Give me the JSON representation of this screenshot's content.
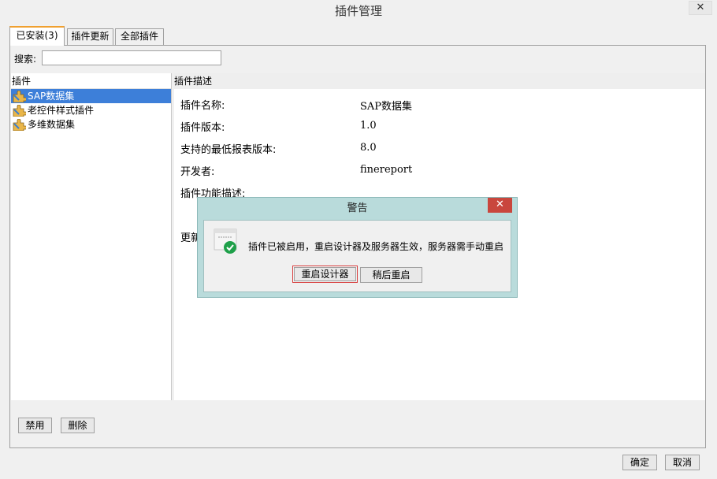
{
  "window": {
    "title": "插件管理",
    "close_label": "✕"
  },
  "tabs": [
    {
      "label": "已安装(3)"
    },
    {
      "label": "插件更新"
    },
    {
      "label": "全部插件"
    }
  ],
  "search": {
    "label": "搜索:",
    "value": ""
  },
  "plugin_list": {
    "header": "插件",
    "items": [
      {
        "label": "SAP数据集",
        "selected": true
      },
      {
        "label": "老控件样式插件"
      },
      {
        "label": "多维数据集"
      }
    ]
  },
  "description": {
    "header": "插件描述",
    "rows": [
      {
        "key": "插件名称:",
        "value": "SAP数据集"
      },
      {
        "key": "插件版本:",
        "value": "1.0"
      },
      {
        "key": "支持的最低报表版本:",
        "value": "8.0"
      },
      {
        "key": "开发者:",
        "value": "finereport"
      },
      {
        "key": "插件功能描述:",
        "value": ""
      },
      {
        "key": "更新",
        "value": ""
      }
    ]
  },
  "panel_buttons": {
    "disable": "禁用",
    "delete": "删除"
  },
  "footer_buttons": {
    "ok": "确定",
    "cancel": "取消"
  },
  "dialog": {
    "title": "警告",
    "close_label": "✕",
    "message": "插件已被启用，重启设计器及服务器生效，服务器需手动重启",
    "restart_label": "重启设计器",
    "later_label": "稍后重启"
  },
  "colors": {
    "selection": "#3d7fd9",
    "dialog_frame": "#b9dbdb",
    "close_red": "#c9463d",
    "tab_accent": "#f0a030",
    "success_green": "#1fa04a"
  }
}
